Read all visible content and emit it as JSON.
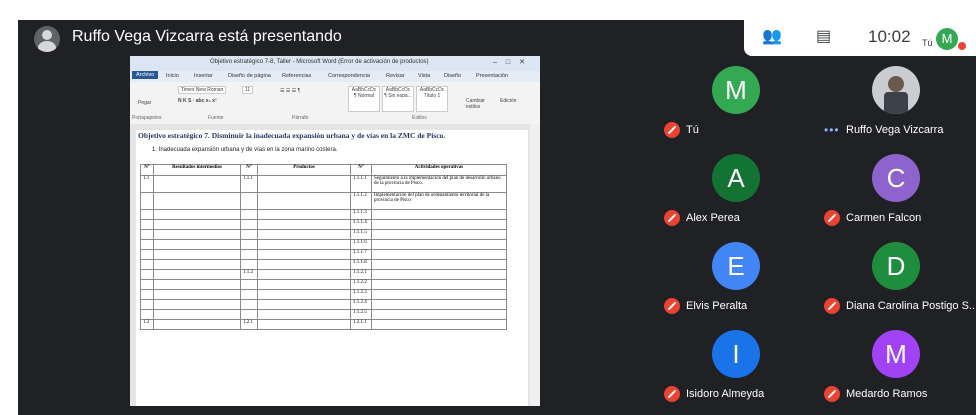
{
  "presenter": {
    "text": "Ruffo Vega Vizcarra está presentando"
  },
  "controls": {
    "people_icon": "people-icon",
    "chat_icon": "chat-icon",
    "time": "10:02",
    "self_label": "Tú",
    "self_initial": "M"
  },
  "word": {
    "title": "Objetivo estratégico 7-8, Taller - Microsoft Word (Error de activación de productos)",
    "tabs": [
      "Archivo",
      "Inicio",
      "Insertar",
      "Diseño de página",
      "Referencias",
      "Correspondencia",
      "Revisar",
      "Vista",
      "Diseño",
      "Presentación"
    ],
    "font_name": "Times New Roman",
    "font_size": "11",
    "paste_label": "Pegar",
    "style_samples": [
      "AaBbCcDc",
      "AaBbCcDc",
      "AaBbCcDc"
    ],
    "style_names": [
      "¶ Normal",
      "¶ Sin espa...",
      "Título 1"
    ],
    "change_styles": "Cambiar estilos",
    "edit_label": "Edición",
    "groups": [
      "Portapapeles",
      "Fuente",
      "Párrafo",
      "Estilos"
    ]
  },
  "document": {
    "heading": "Objetivo estratégico 7. Disminuir la inadecuada expansión urbana y de vías en la ZMC de Pisco.",
    "list_item": "1.  Inadecuada expansión urbana y de vías en la zona marino costera.",
    "headers": [
      "N°",
      "Resultados intermedios",
      "N°",
      "Productos",
      "N°",
      "Actividades operativas"
    ],
    "rows": [
      {
        "n1": "1.1",
        "n2": "1.1.1",
        "n3": "1.1.1.1",
        "act": "Seguimiento a la implementación del plan de desarrollo urbano de la provincia de Pisco."
      },
      {
        "n1": "",
        "n2": "",
        "n3": "1.1.1.2",
        "act": "Implementación del plan de ordenamiento territorial de la provincia de Pisco"
      },
      {
        "n1": "",
        "n2": "",
        "n3": "1.1.1.3",
        "act": ""
      },
      {
        "n1": "",
        "n2": "",
        "n3": "1.1.1.4",
        "act": ""
      },
      {
        "n1": "",
        "n2": "",
        "n3": "1.1.1.5",
        "act": ""
      },
      {
        "n1": "",
        "n2": "",
        "n3": "1.1.1.6",
        "act": ""
      },
      {
        "n1": "",
        "n2": "",
        "n3": "1.1.1.7",
        "act": ""
      },
      {
        "n1": "",
        "n2": "",
        "n3": "1.1.1.8",
        "act": ""
      },
      {
        "n1": "",
        "n2": "1.1.2",
        "n3": "1.1.2.1",
        "act": ""
      },
      {
        "n1": "",
        "n2": "",
        "n3": "1.1.2.2",
        "act": ""
      },
      {
        "n1": "",
        "n2": "",
        "n3": "1.1.2.3",
        "act": ""
      },
      {
        "n1": "",
        "n2": "",
        "n3": "1.1.2.4",
        "act": ""
      },
      {
        "n1": "",
        "n2": "",
        "n3": "1.1.2.5",
        "act": ""
      },
      {
        "n1": "1.2",
        "n2": "1.2.1",
        "n3": "1.2.1.1",
        "act": ""
      }
    ]
  },
  "participants": [
    {
      "name": "Tú",
      "initial": "M",
      "color": "#34a853",
      "muted": true
    },
    {
      "name": "Ruffo Vega Vizcarra",
      "initial": "",
      "color": "",
      "muted": false
    },
    {
      "name": "Alex Perea",
      "initial": "A",
      "color": "#137333",
      "muted": true
    },
    {
      "name": "Carmen Falcon",
      "initial": "C",
      "color": "#8e63ce",
      "muted": true
    },
    {
      "name": "Elvis Peralta",
      "initial": "E",
      "color": "#4285f4",
      "muted": true
    },
    {
      "name": "Diana Carolina Postigo S...",
      "initial": "D",
      "color": "#1e8e3e",
      "muted": true
    },
    {
      "name": "Isidoro Almeyda",
      "initial": "I",
      "color": "#1a73e8",
      "muted": true
    },
    {
      "name": "Medardo Ramos",
      "initial": "M",
      "color": "#a142f4",
      "muted": true
    }
  ]
}
